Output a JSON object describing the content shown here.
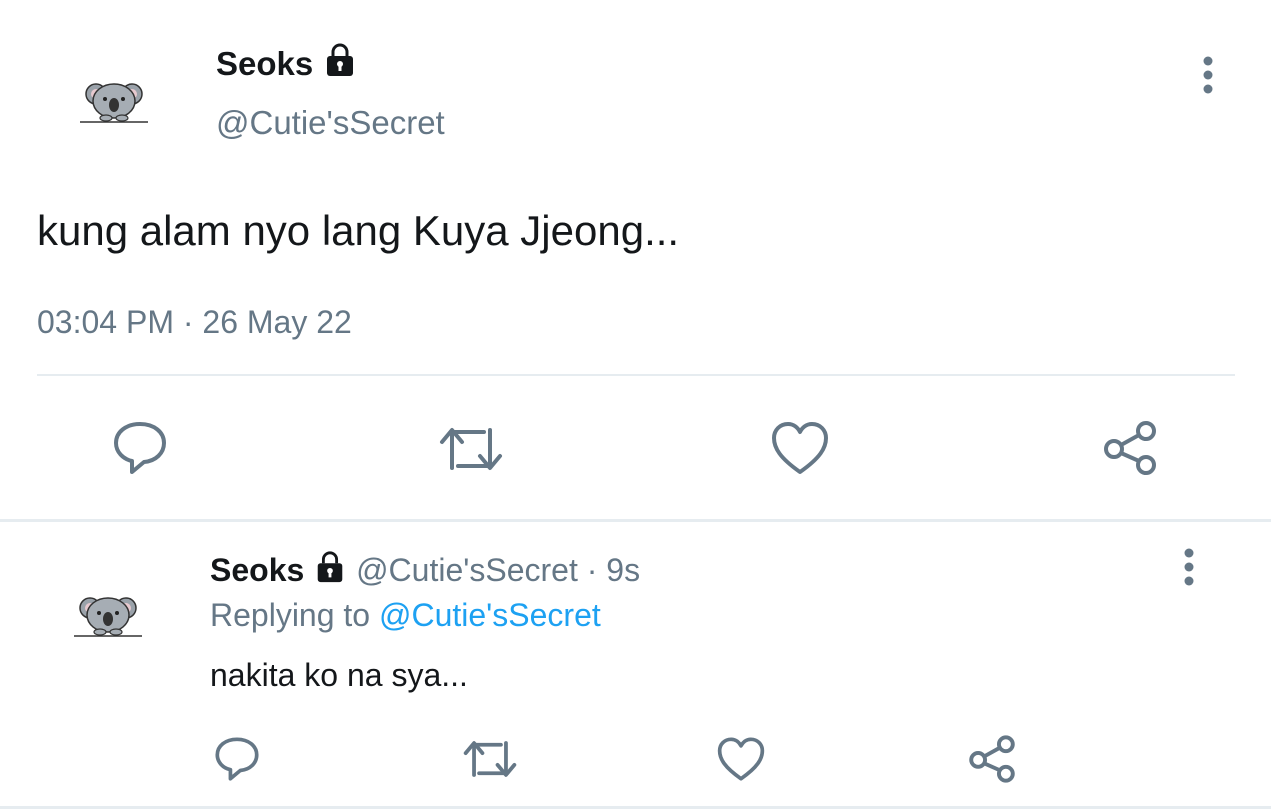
{
  "main_tweet": {
    "display_name": "Seoks",
    "handle": "@Cutie'sSecret",
    "text": "kung alam nyo lang Kuya Jjeong...",
    "time": "03:04 PM",
    "separator": "·",
    "date": "26 May 22"
  },
  "reply_tweet": {
    "display_name": "Seoks",
    "handle": "@Cutie'sSecret",
    "separator": "·",
    "age": "9s",
    "replying_prefix": "Replying to",
    "replying_handle": "@Cutie'sSecret",
    "text": "nakita ko na sya..."
  },
  "icons": {
    "avatar": "koala-avatar-icon",
    "lock": "lock-icon",
    "more": "more-vertical-icon",
    "reply": "reply-icon",
    "retweet": "retweet-icon",
    "like": "heart-icon",
    "share": "share-icon"
  },
  "colors": {
    "text": "#14171a",
    "muted": "#657786",
    "link": "#1da1f2",
    "divider": "#e6ecf0"
  }
}
